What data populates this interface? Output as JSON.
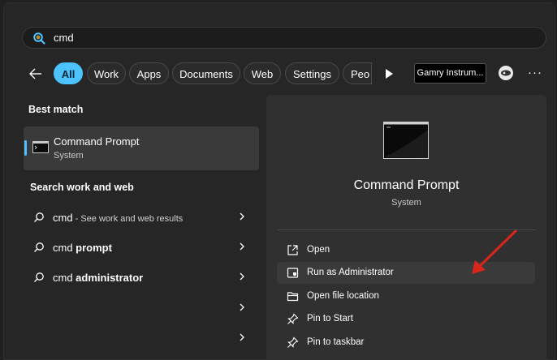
{
  "search": {
    "value": "cmd",
    "icon": "search-icon"
  },
  "filters": {
    "chips": [
      "All",
      "Work",
      "Apps",
      "Documents",
      "Web",
      "Settings",
      "Peo"
    ],
    "active": "All",
    "account_label": "Gamry Instrum...",
    "more_label": "···"
  },
  "best_match": {
    "heading": "Best match",
    "app_name": "Command Prompt",
    "app_type": "System"
  },
  "search_web": {
    "heading": "Search work and web",
    "rows": [
      {
        "query": "cmd",
        "suffix": " - See work and web results"
      },
      {
        "query": "cmd ",
        "bold": "prompt"
      },
      {
        "query": "cmd ",
        "bold": "administrator"
      }
    ]
  },
  "preview": {
    "title": "Command Prompt",
    "subtitle": "System",
    "actions": [
      {
        "label": "Open",
        "icon": "open-icon"
      },
      {
        "label": "Run as Administrator",
        "icon": "shield-icon"
      },
      {
        "label": "Open file location",
        "icon": "folder-icon"
      },
      {
        "label": "Pin to Start",
        "icon": "pin-icon"
      },
      {
        "label": "Pin to taskbar",
        "icon": "pin-icon"
      }
    ]
  },
  "colors": {
    "accent": "#4cc2ff",
    "annotation_arrow": "#d8261c",
    "background": "#262626",
    "preview_background": "#303030"
  }
}
